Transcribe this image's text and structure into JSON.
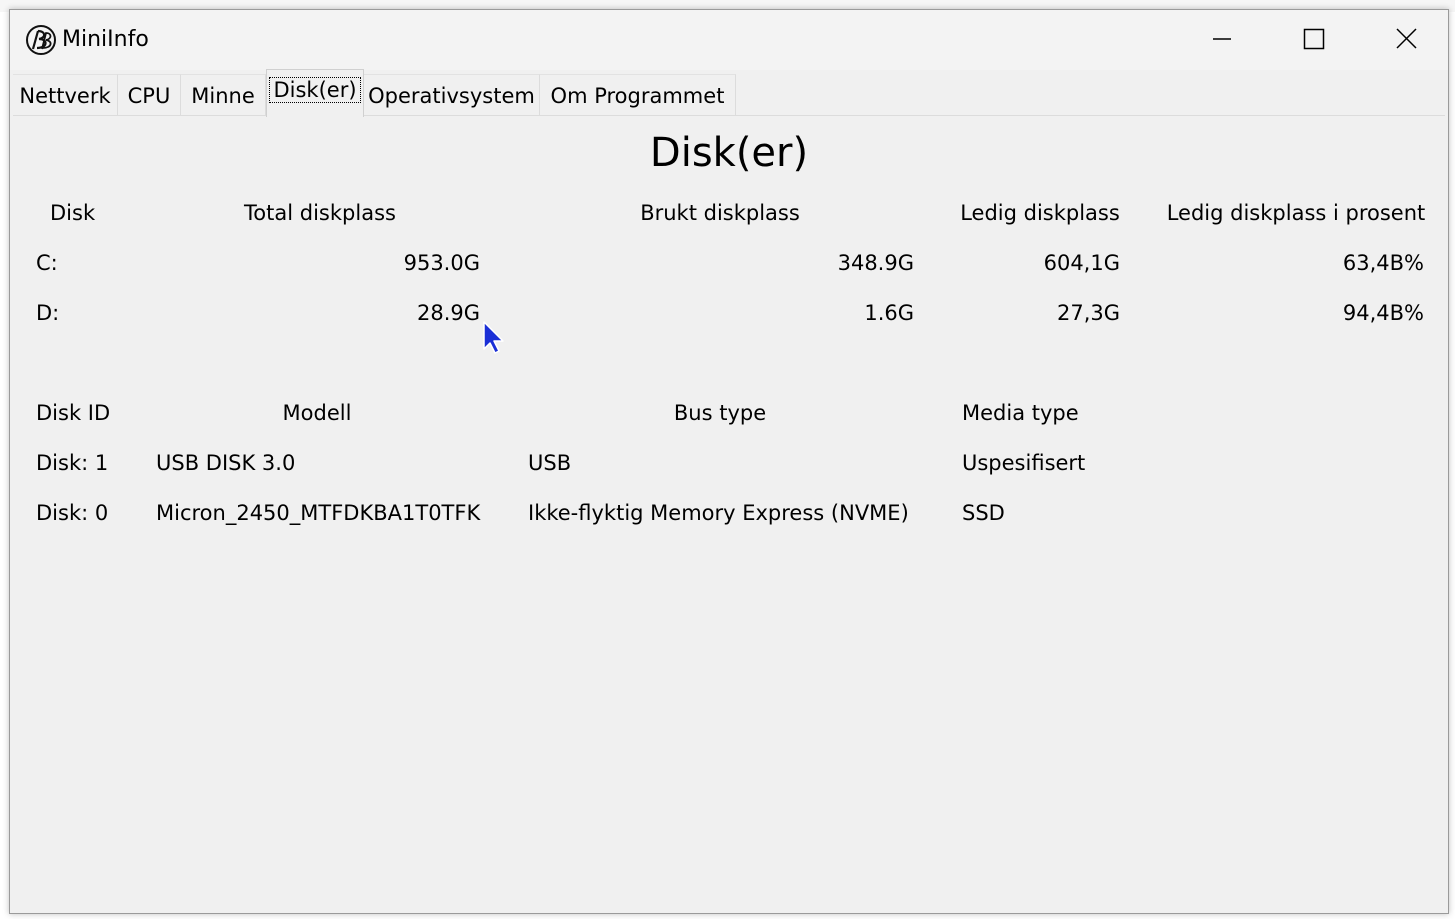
{
  "window": {
    "title": "MiniInfo"
  },
  "tabs": [
    {
      "label": "Nettverk"
    },
    {
      "label": "CPU"
    },
    {
      "label": "Minne"
    },
    {
      "label": "Disk(er)"
    },
    {
      "label": "Operativsystem"
    },
    {
      "label": "Om Programmet"
    }
  ],
  "active_tab": "Disk(er)",
  "page": {
    "heading": "Disk(er)"
  },
  "space_table": {
    "headers": [
      "Disk",
      "Total diskplass",
      "Brukt diskplass",
      "Ledig diskplass",
      "Ledig diskplass i prosent"
    ],
    "rows": [
      [
        "C:",
        "953.0G",
        "348.9G",
        "604,1G",
        "63,4B%"
      ],
      [
        "D:",
        "28.9G",
        "1.6G",
        "27,3G",
        "94,4B%"
      ]
    ]
  },
  "disk_table": {
    "headers": [
      "Disk ID",
      "Modell",
      "Bus type",
      "Media type"
    ],
    "rows": [
      [
        "Disk: 1",
        "USB DISK 3.0",
        "USB",
        "Uspesifisert"
      ],
      [
        "Disk: 0",
        "Micron_2450_MTFDKBA1T0TFK",
        "Ikke-flyktig Memory Express (NVME)",
        "SSD"
      ]
    ]
  },
  "colors": {
    "window_bg": "#f0f0f0",
    "cursor": "#1a2fd6"
  }
}
